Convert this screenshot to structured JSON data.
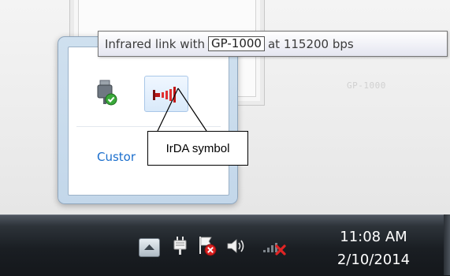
{
  "tooltip": {
    "prefix": "Infrared link with",
    "device": "GP-1000",
    "suffix": "at 115200 bps"
  },
  "background": {
    "ghost_text": "GP-1000"
  },
  "flyout": {
    "icons": [
      {
        "name": "usb-safely-remove-icon",
        "color": "#3aa93a"
      },
      {
        "name": "irda-icon",
        "color": "#d11a1a"
      }
    ],
    "customize_link": "Custor"
  },
  "annotation": {
    "label": "IrDA symbol"
  },
  "taskbar": {
    "icons": [
      "show-hidden-icons-button",
      "power-plug-icon",
      "action-center-flag-icon",
      "volume-icon",
      "network-disconnected-icon"
    ],
    "clock": {
      "time": "11:08 AM",
      "date": "2/10/2014"
    }
  }
}
